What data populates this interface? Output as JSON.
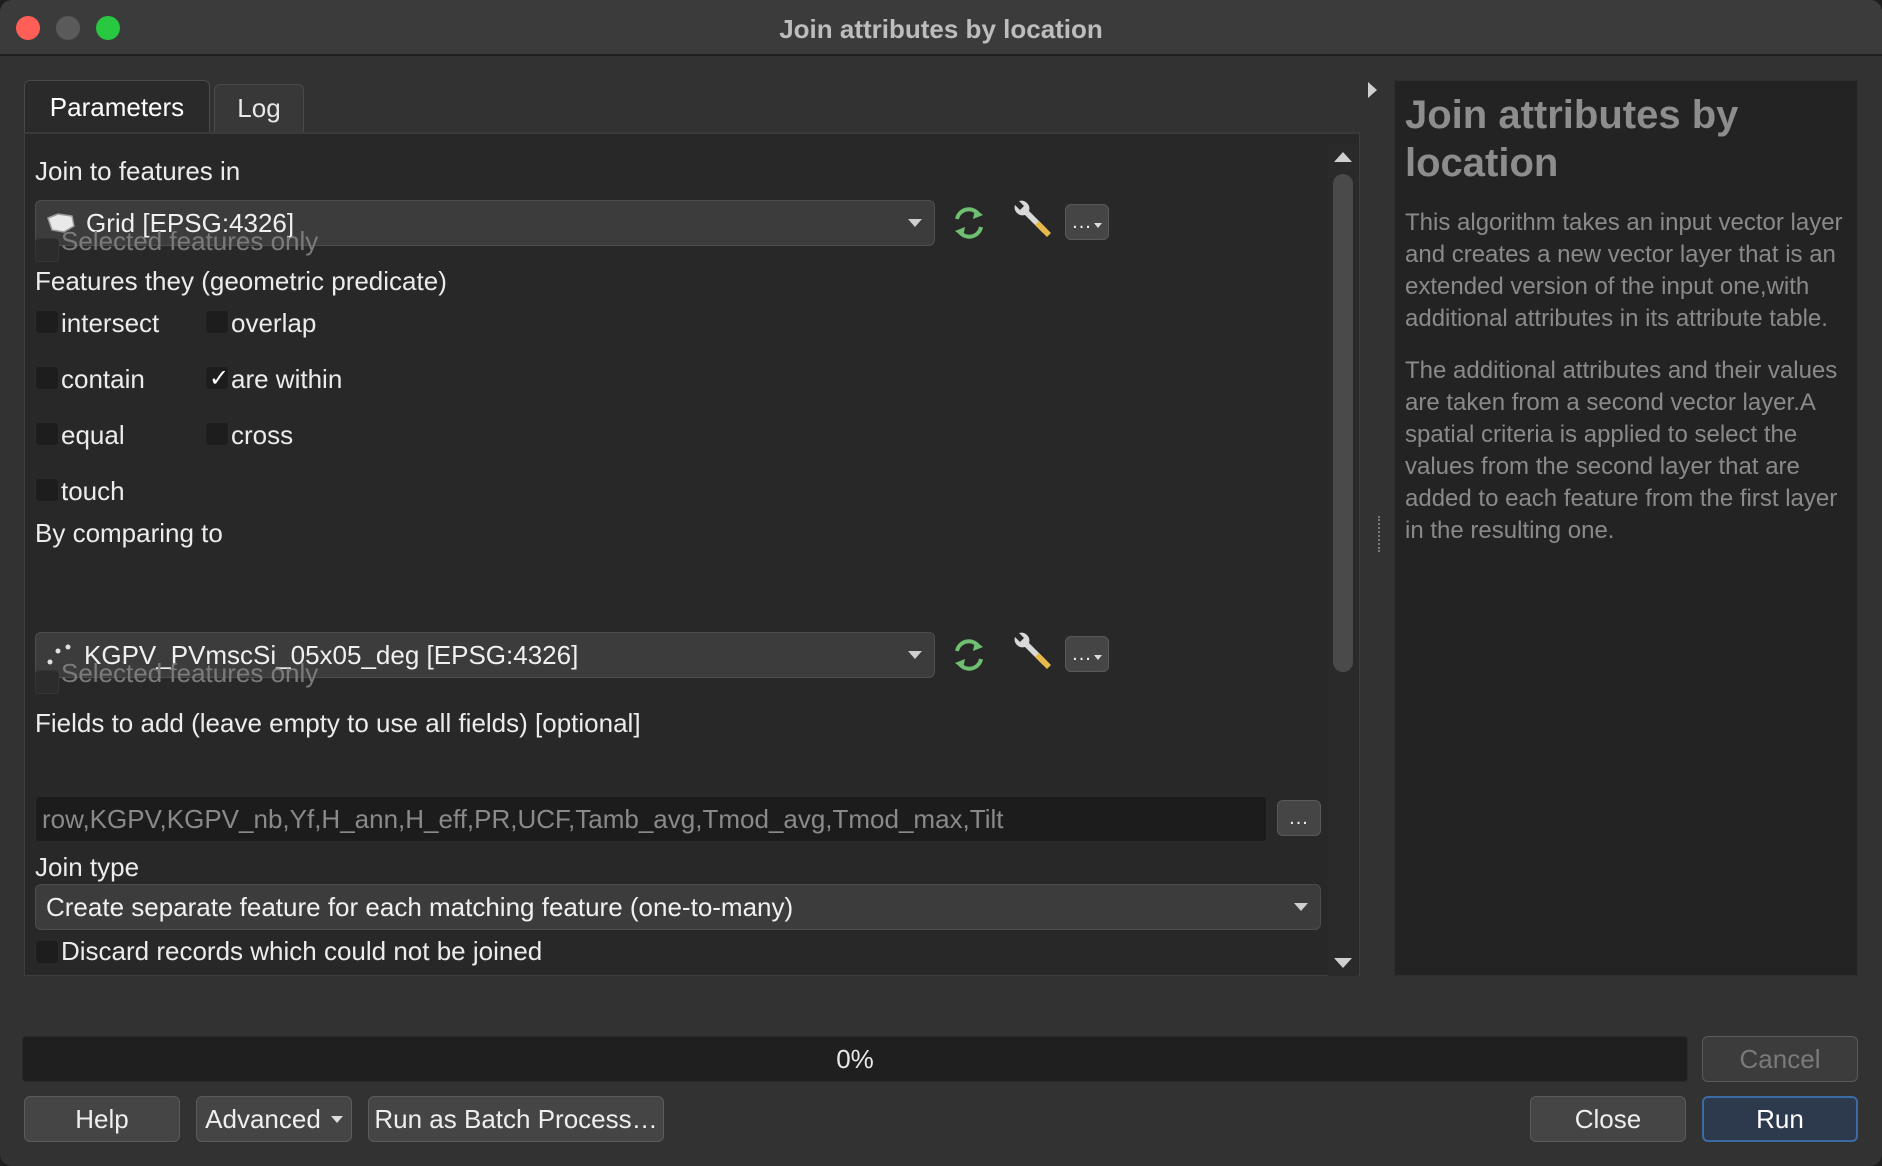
{
  "window": {
    "title": "Join attributes by location"
  },
  "tabs": [
    {
      "label": "Parameters"
    },
    {
      "label": "Log"
    }
  ],
  "params": {
    "join_to": {
      "label": "Join to features in",
      "value": "Grid [EPSG:4326]",
      "selected_only_label": "Selected features only"
    },
    "predicate": {
      "label": "Features they (geometric predicate)",
      "options": {
        "intersect": "intersect",
        "overlap": "overlap",
        "contain": "contain",
        "are_within": "are within",
        "equal": "equal",
        "cross": "cross",
        "touch": "touch"
      },
      "checked": [
        "are within"
      ]
    },
    "compare_to": {
      "label": "By comparing to",
      "value": "KGPV_PVmscSi_05x05_deg [EPSG:4326]",
      "selected_only_label": "Selected features only"
    },
    "fields": {
      "label": "Fields to add (leave empty to use all fields) [optional]",
      "value": "row,KGPV,KGPV_nb,Yf,H_ann,H_eff,PR,UCF,Tamb_avg,Tmod_avg,Tmod_max,Tilt",
      "browse_label": "..."
    },
    "join_type": {
      "label": "Join type",
      "value": "Create separate feature for each matching feature (one-to-many)"
    },
    "discard": {
      "label": "Discard records which could not be joined"
    },
    "more_label": "..."
  },
  "help": {
    "title": "Join attributes by location",
    "paragraphs": [
      "This algorithm takes an input vector layer and creates a new vector layer that is an extended version of the input one,with additional attributes in its attribute table.",
      "The additional attributes and their values are taken from a second vector layer.A spatial criteria is applied to select the values from the second layer that are added to each feature from the first layer in the resulting one."
    ]
  },
  "progress": {
    "value": 0,
    "text": "0%"
  },
  "buttons": {
    "cancel": "Cancel",
    "help": "Help",
    "advanced": "Advanced",
    "batch": "Run as Batch Process…",
    "close": "Close",
    "run": "Run"
  },
  "colors": {
    "run_border": "#3c6aa3",
    "refresh_icon": "#6fbf73",
    "wrench_handle": "#e8b84a"
  },
  "icons": [
    "polygon-layer-icon",
    "point-layer-icon",
    "refresh-icon",
    "wrench-icon",
    "chevron-down-icon",
    "scroll-up-icon",
    "scroll-down-icon",
    "collapse-arrow-icon",
    "checkmark-icon"
  ]
}
